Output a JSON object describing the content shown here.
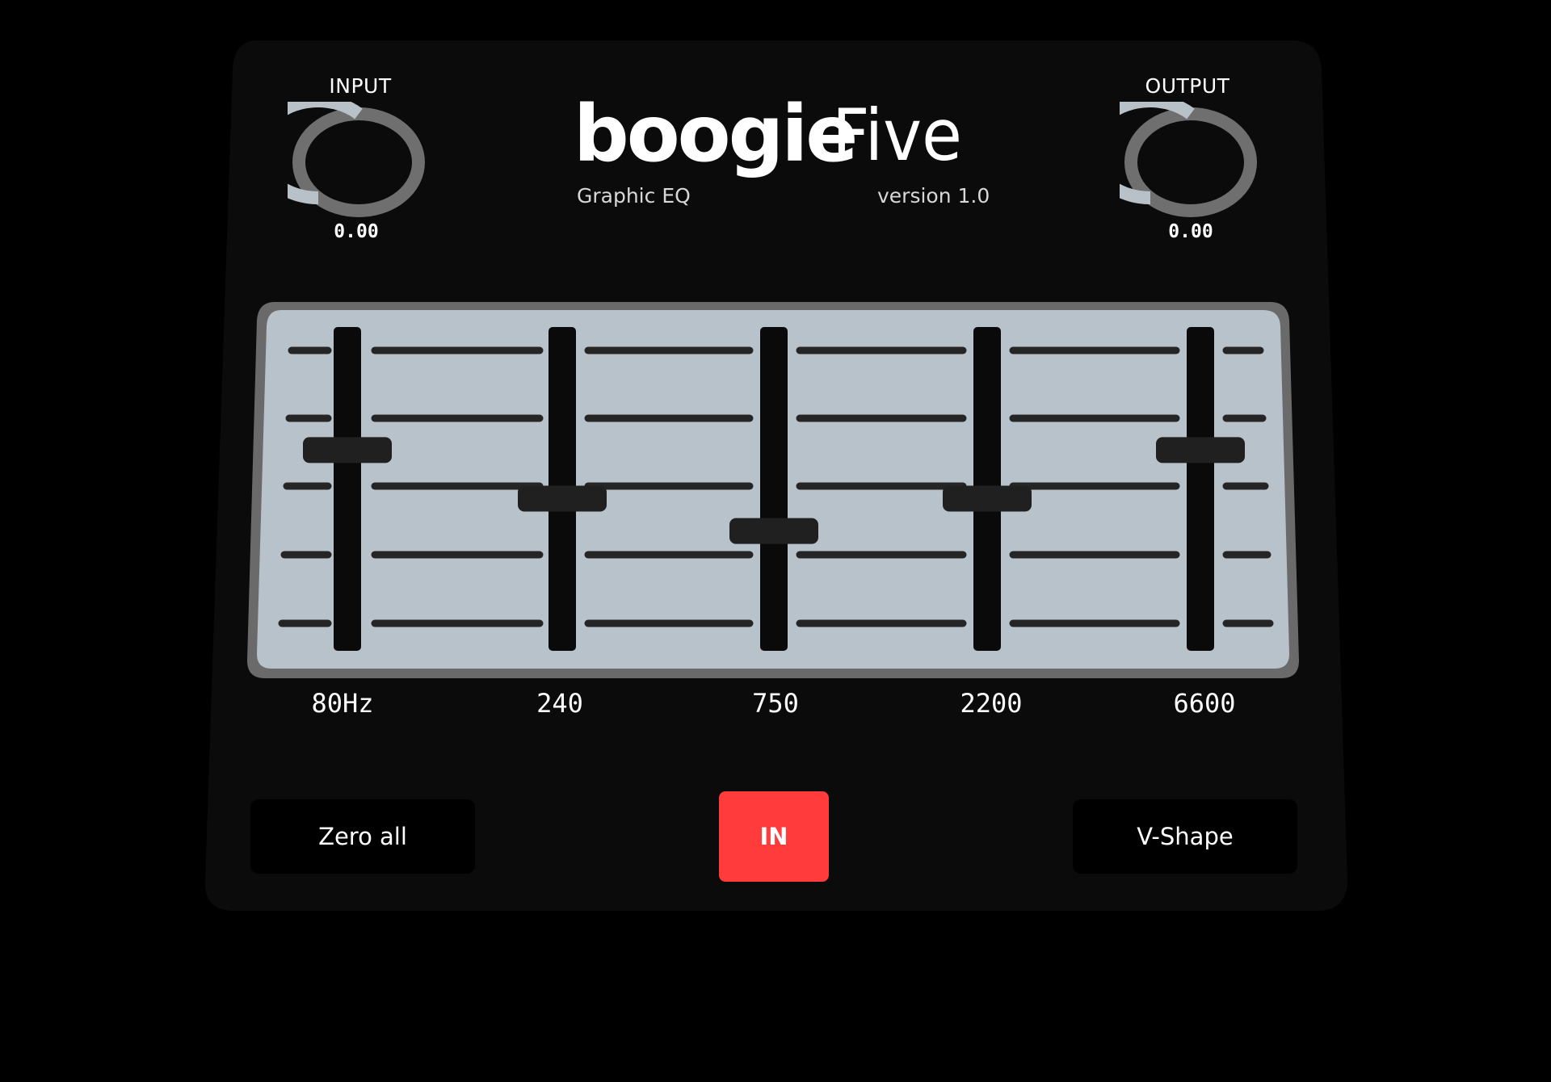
{
  "app": {
    "name_bold": "boogie",
    "name_light": "Five",
    "subtitle": "Graphic EQ",
    "version": "version 1.0"
  },
  "input": {
    "label": "INPUT",
    "value": "0.00"
  },
  "output": {
    "label": "OUTPUT",
    "value": "0.00"
  },
  "bands": [
    {
      "label": "80Hz",
      "level": 0.62
    },
    {
      "label": "240",
      "level": 0.47
    },
    {
      "label": "750",
      "level": 0.37
    },
    {
      "label": "2200",
      "level": 0.47
    },
    {
      "label": "6600",
      "level": 0.62
    }
  ],
  "buttons": {
    "zero_all": "Zero all",
    "in": "IN",
    "v_shape": "V-Shape"
  },
  "colors": {
    "background": "#000000",
    "panel": "#0b0b0b",
    "eq_screen": "#b8c2cb",
    "fader_track": "#0a0a0a",
    "fader_cap": "#202020",
    "in_button": "#ff3b3b",
    "knob_arc_light": "#b9c1c8",
    "knob_arc_dark": "#6f6f6f"
  },
  "icons": {
    "input_knob": "rotary-knob-icon",
    "output_knob": "rotary-knob-icon"
  }
}
